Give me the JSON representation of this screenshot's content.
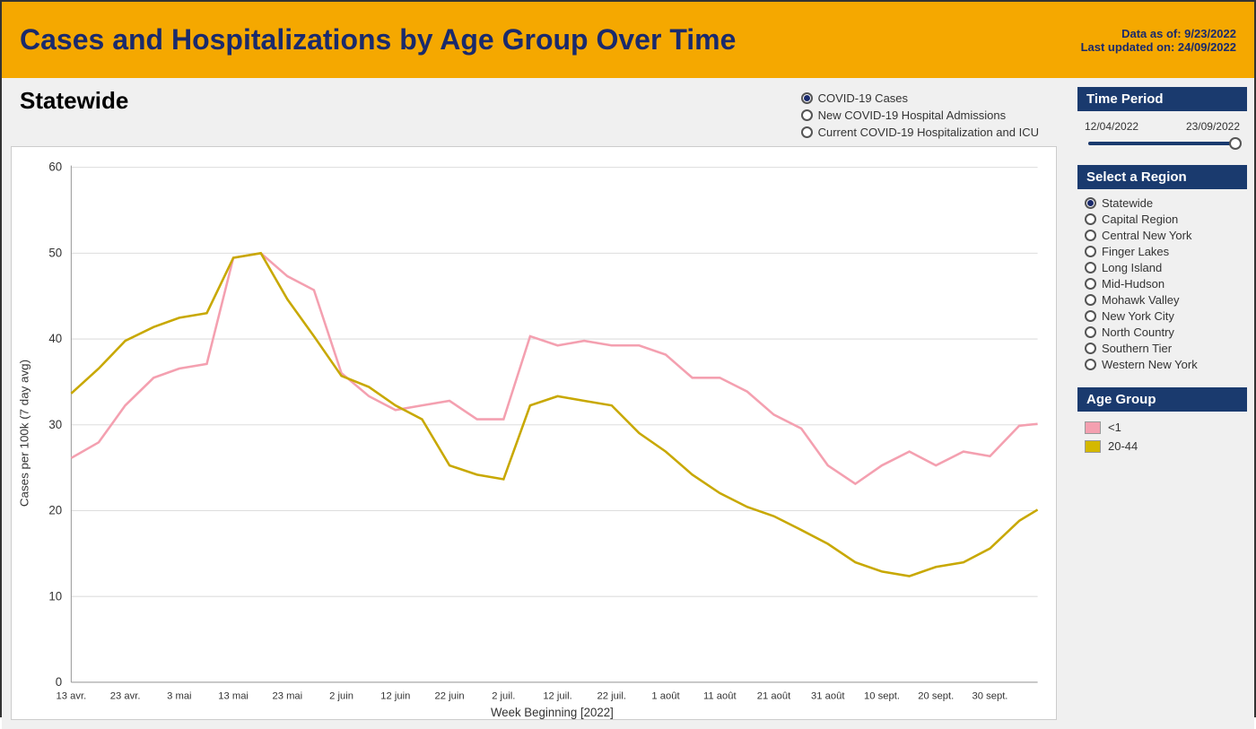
{
  "header": {
    "title": "Cases and Hospitalizations by Age Group Over Time",
    "data_as_of": "Data as of: 9/23/2022",
    "last_updated": "Last updated on: 24/09/2022"
  },
  "chart": {
    "title": "Statewide",
    "y_axis_label": "Cases per 100k (7 day avg)",
    "x_axis_label": "Week Beginning [2022]",
    "x_ticks": [
      "13 avr.",
      "23 avr.",
      "3 mai",
      "13 mai",
      "23 mai",
      "2 juin",
      "12 juin",
      "22 juin",
      "2 juil.",
      "12 juil.",
      "22 juil.",
      "1 août",
      "11 août",
      "21 août",
      "31 août",
      "10 sept.",
      "20 sept.",
      "30 sept."
    ],
    "y_ticks": [
      "0",
      "10",
      "20",
      "30",
      "40",
      "50",
      "60"
    ]
  },
  "legend": {
    "items": [
      {
        "label": "COVID-19 Cases",
        "selected": true
      },
      {
        "label": "New COVID-19 Hospital Admissions",
        "selected": false
      },
      {
        "label": "Current COVID-19 Hospitalization and ICU",
        "selected": false
      }
    ]
  },
  "time_period": {
    "label": "Time Period",
    "start_date": "12/04/2022",
    "end_date": "23/09/2022"
  },
  "regions": {
    "label": "Select a Region",
    "items": [
      {
        "label": "Statewide",
        "selected": true
      },
      {
        "label": "Capital Region",
        "selected": false
      },
      {
        "label": "Central New York",
        "selected": false
      },
      {
        "label": "Finger Lakes",
        "selected": false
      },
      {
        "label": "Long Island",
        "selected": false
      },
      {
        "label": "Mid-Hudson",
        "selected": false
      },
      {
        "label": "Mohawk Valley",
        "selected": false
      },
      {
        "label": "New York City",
        "selected": false
      },
      {
        "label": "North Country",
        "selected": false
      },
      {
        "label": "Southern Tier",
        "selected": false
      },
      {
        "label": "Western New York",
        "selected": false
      }
    ]
  },
  "age_groups": {
    "label": "Age Group",
    "items": [
      {
        "label": "<1",
        "color": "#F4A0B0"
      },
      {
        "label": "20-44",
        "color": "#D4B800"
      }
    ]
  }
}
